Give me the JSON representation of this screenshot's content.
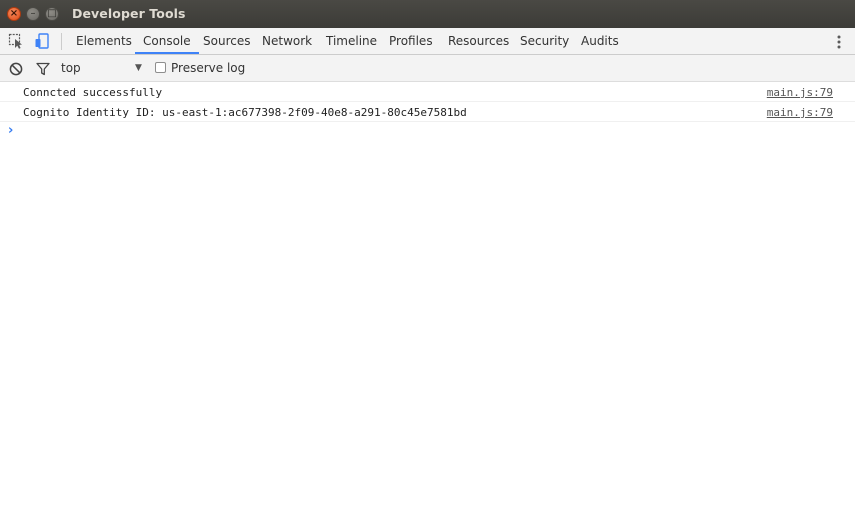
{
  "window": {
    "title": "Developer Tools",
    "close_glyph": "×",
    "minimize_glyph": "–",
    "maximize_glyph": "□"
  },
  "toolbar": {
    "inspect_icon": "inspect-element-icon",
    "device_icon": "device-mode-icon",
    "tabs": [
      {
        "label": "Elements",
        "active": false
      },
      {
        "label": "Console",
        "active": true
      },
      {
        "label": "Sources",
        "active": false
      },
      {
        "label": "Network",
        "active": false
      },
      {
        "label": "Timeline",
        "active": false
      },
      {
        "label": "Profiles",
        "active": false
      },
      {
        "label": "Resources",
        "active": false
      },
      {
        "label": "Security",
        "active": false
      },
      {
        "label": "Audits",
        "active": false
      }
    ],
    "more_icon": "vertical-ellipsis-icon"
  },
  "console_toolbar": {
    "clear_icon": "clear-console-icon",
    "filter_icon": "filter-icon",
    "context": "top",
    "dropdown_glyph": "▼",
    "preserve_log_label": "Preserve log",
    "preserve_log_checked": false
  },
  "messages": [
    {
      "text": "Conncted successfully",
      "source": "main.js:79"
    },
    {
      "text": "Cognito Identity ID: us-east-1:ac677398-2f09-40e8-a291-80c45e7581bd",
      "source": "main.js:79"
    }
  ],
  "prompt": {
    "glyph": "›",
    "value": ""
  },
  "colors": {
    "titlebar": "#3c3b37",
    "accent": "#3e82f7",
    "toolbar_bg": "#f3f3f3",
    "close_button": "#df4a16"
  }
}
